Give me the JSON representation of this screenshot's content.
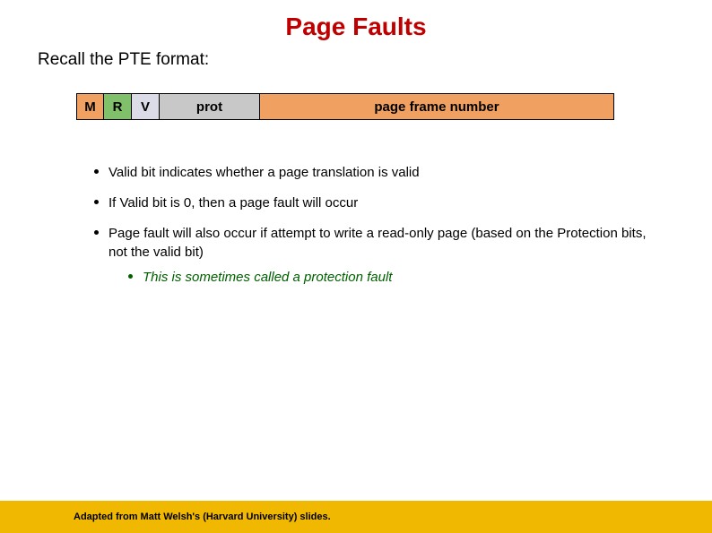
{
  "title": "Page Faults",
  "subtitle": "Recall the PTE format:",
  "pte": {
    "m": "M",
    "r": "R",
    "v": "V",
    "prot": "prot",
    "pfn": "page frame number"
  },
  "bullets": {
    "b1": "Valid bit indicates whether a page translation is valid",
    "b2": "If Valid bit is 0, then a page fault will occur",
    "b3": "Page fault will also occur if attempt to write a read-only page (based on the Protection bits, not the valid bit)",
    "b3sub": "This is sometimes called a protection fault"
  },
  "footer": "Adapted from Matt Welsh's (Harvard University) slides."
}
